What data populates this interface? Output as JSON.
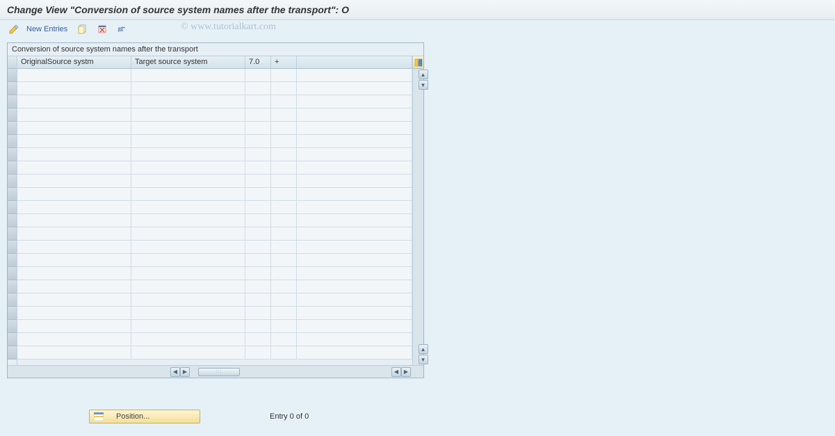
{
  "title": "Change View \"Conversion of source system names after the transport\": O",
  "watermark": "© www.tutorialkart.com",
  "toolbar": {
    "new_entries_label": "New Entries"
  },
  "panel": {
    "header": "Conversion of source system names after the transport",
    "columns": [
      "OriginalSource systm",
      "Target source system",
      "7.0",
      "+",
      ""
    ],
    "row_count": 22
  },
  "footer": {
    "position_label": "Position...",
    "entry_text": "Entry 0 of 0"
  }
}
